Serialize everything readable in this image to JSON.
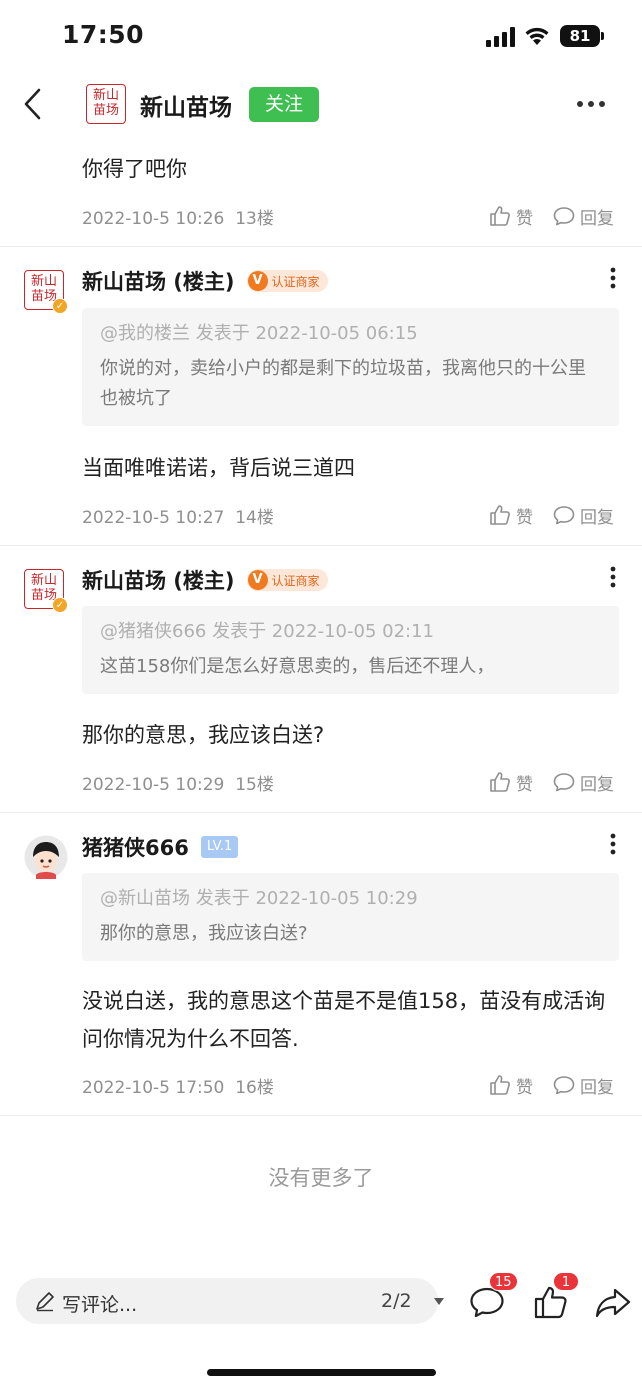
{
  "status_bar": {
    "time": "17:50",
    "battery": "81"
  },
  "header": {
    "title": "新山苗场",
    "follow_label": "关注",
    "logo_text_top": "新山",
    "logo_text_bottom": "苗场"
  },
  "posts": [
    {
      "text": "你得了吧你",
      "date": "2022-10-5 10:26",
      "floor": "13楼",
      "like_label": "赞",
      "reply_label": "回复"
    },
    {
      "author": "新山苗场 (楼主)",
      "badge": "认证商家",
      "badge_v": "V",
      "quote_meta": "@我的楼兰 发表于 2022-10-05 06:15",
      "quote_body": "你说的对，卖给小户的都是剩下的垃圾苗，我离他只的十公里也被坑了",
      "text": "当面唯唯诺诺，背后说三道四",
      "date": "2022-10-5 10:27",
      "floor": "14楼",
      "like_label": "赞",
      "reply_label": "回复"
    },
    {
      "author": "新山苗场 (楼主)",
      "badge": "认证商家",
      "badge_v": "V",
      "quote_meta": "@猪猪侠666 发表于 2022-10-05 02:11",
      "quote_body": "这苗158你们是怎么好意思卖的，售后还不理人，",
      "text": "那你的意思，我应该白送?",
      "date": "2022-10-5 10:29",
      "floor": "15楼",
      "like_label": "赞",
      "reply_label": "回复"
    },
    {
      "author": "猪猪侠666",
      "level": "LV.1",
      "quote_meta": "@新山苗场 发表于 2022-10-05 10:29",
      "quote_body": "那你的意思，我应该白送?",
      "text": "没说白送，我的意思这个苗是不是值158，苗没有成活询问你情况为什么不回答.",
      "date": "2022-10-5 17:50",
      "floor": "16楼",
      "like_label": "赞",
      "reply_label": "回复"
    }
  ],
  "footer_note": "没有更多了",
  "bottom_bar": {
    "comment_placeholder": "写评论...",
    "page_indicator": "2/2",
    "comments_count": "15",
    "likes_count": "1"
  },
  "colors": {
    "follow_green": "#3fbe52",
    "merchant_orange": "#f07a1f",
    "badge_red": "#e9353a",
    "logo_red": "#c8262b",
    "level_blue": "#a8c9f3"
  },
  "icons": [
    "back-icon",
    "more-icon",
    "like-icon",
    "reply-icon",
    "pen-icon",
    "comment-icon",
    "thumbs-up-icon",
    "share-icon"
  ]
}
